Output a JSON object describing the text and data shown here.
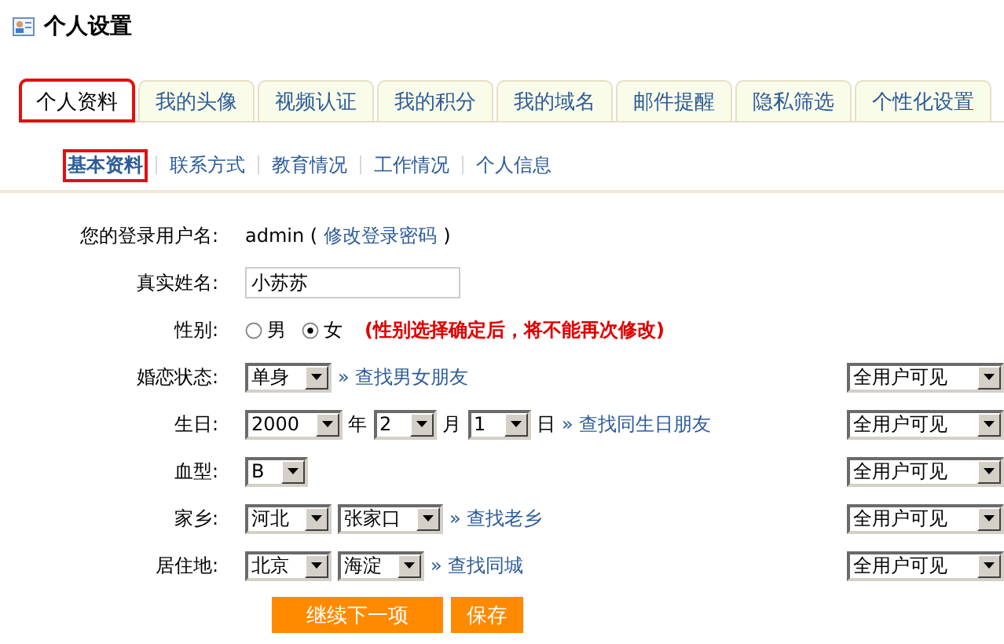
{
  "page_title": "个人设置",
  "tabs": [
    {
      "label": "个人资料",
      "selected": true,
      "highlighted": true
    },
    {
      "label": "我的头像",
      "selected": false,
      "highlighted": false
    },
    {
      "label": "视频认证",
      "selected": false,
      "highlighted": false
    },
    {
      "label": "我的积分",
      "selected": false,
      "highlighted": false
    },
    {
      "label": "我的域名",
      "selected": false,
      "highlighted": false
    },
    {
      "label": "邮件提醒",
      "selected": false,
      "highlighted": false
    },
    {
      "label": "隐私筛选",
      "selected": false,
      "highlighted": false
    },
    {
      "label": "个性化设置",
      "selected": false,
      "highlighted": false
    }
  ],
  "subtabs": [
    {
      "label": "基本资料",
      "selected": true,
      "highlighted": true
    },
    {
      "label": "联系方式",
      "selected": false,
      "highlighted": false
    },
    {
      "label": "教育情况",
      "selected": false,
      "highlighted": false
    },
    {
      "label": "工作情况",
      "selected": false,
      "highlighted": false
    },
    {
      "label": "个人信息",
      "selected": false,
      "highlighted": false
    }
  ],
  "form": [
    {
      "label": "您的登录用户名:",
      "controls": [
        {
          "kind": "text",
          "text": "admin ("
        },
        {
          "kind": "link",
          "text": "修改登录密码"
        },
        {
          "kind": "text",
          "text": ")"
        }
      ]
    },
    {
      "label": "真实姓名:",
      "controls": [
        {
          "kind": "input",
          "value": "小苏苏"
        }
      ]
    },
    {
      "label": "性别:",
      "controls": [
        {
          "kind": "radio",
          "options": [
            {
              "label": "男",
              "selected": false
            },
            {
              "label": "女",
              "selected": true
            }
          ]
        },
        {
          "kind": "note",
          "text": "(性别选择确定后，将不能再次修改)"
        }
      ]
    },
    {
      "label": "婚恋状态:",
      "privacy": "全用户可见",
      "controls": [
        {
          "kind": "select",
          "value": "单身"
        },
        {
          "kind": "link",
          "text": "» 查找男女朋友"
        }
      ]
    },
    {
      "label": "生日:",
      "privacy": "全用户可见",
      "controls": [
        {
          "kind": "select",
          "value": "2000"
        },
        {
          "kind": "text",
          "text": "年"
        },
        {
          "kind": "select",
          "value": "2"
        },
        {
          "kind": "text",
          "text": "月"
        },
        {
          "kind": "select",
          "value": "1"
        },
        {
          "kind": "text",
          "text": "日"
        },
        {
          "kind": "link",
          "text": "» 查找同生日朋友"
        }
      ]
    },
    {
      "label": "血型:",
      "privacy": "全用户可见",
      "controls": [
        {
          "kind": "select",
          "value": "B"
        }
      ]
    },
    {
      "label": "家乡:",
      "privacy": "全用户可见",
      "controls": [
        {
          "kind": "select",
          "value": "河北"
        },
        {
          "kind": "select",
          "value": "张家口"
        },
        {
          "kind": "link",
          "text": "» 查找老乡"
        }
      ]
    },
    {
      "label": "居住地:",
      "privacy": "全用户可见",
      "controls": [
        {
          "kind": "select",
          "value": "北京"
        },
        {
          "kind": "select",
          "value": "海淀"
        },
        {
          "kind": "link",
          "text": "» 查找同城"
        }
      ]
    }
  ],
  "buttons": [
    "继续下一项",
    "保存"
  ]
}
